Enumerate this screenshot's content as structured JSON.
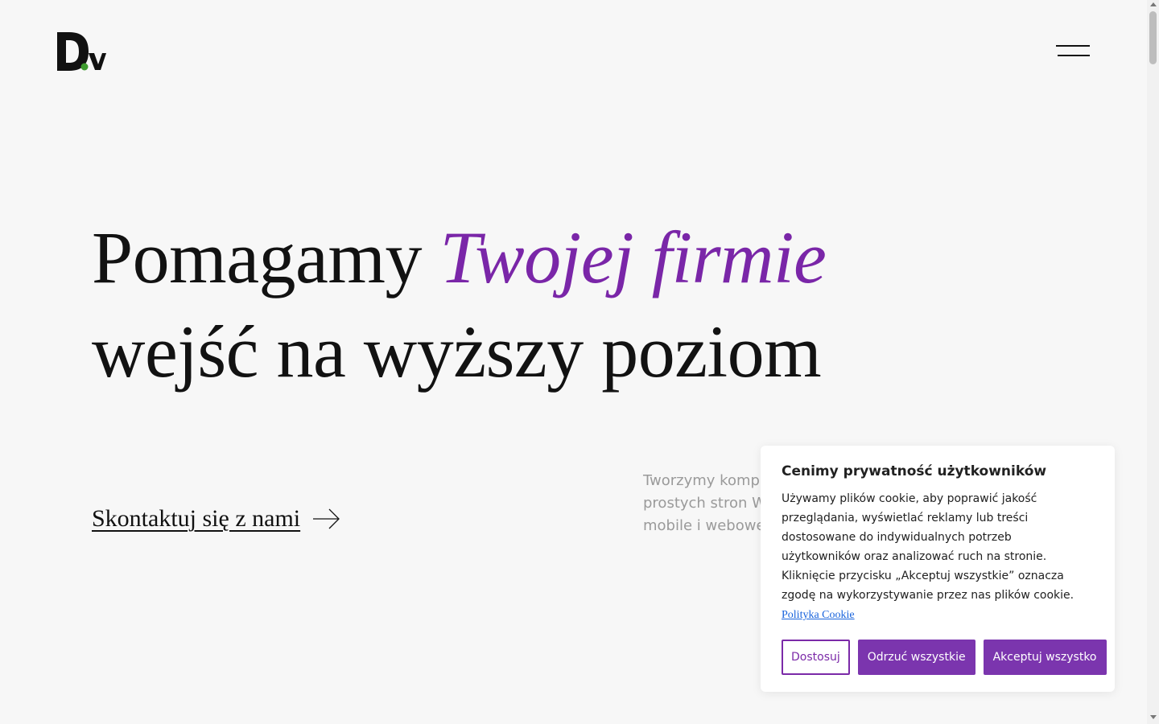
{
  "brand": {
    "logo_text": "Dv",
    "logo_dot_color": "#3d9b2e"
  },
  "header": {
    "menu_icon": "hamburger-icon"
  },
  "hero": {
    "title_part1": "Pomagamy ",
    "title_accent": "Twojej firmie",
    "title_part2": "wejść na wyższy poziom",
    "accent_color": "#7a26a8"
  },
  "cta": {
    "label": "Skontaktuj się z nami",
    "icon": "arrow-right-icon"
  },
  "intro": {
    "line1": "Tworzymy komp",
    "line2": "prostych stron W",
    "line3": "mobile i webowe"
  },
  "cookie_banner": {
    "title": "Cenimy prywatność użytkowników",
    "body": "Używamy plików cookie, aby poprawić jakość przeglądania, wyświetlać reklamy lub treści dostosowane do indywidualnych potrzeb użytkowników oraz analizować ruch na stronie. Kliknięcie przycisku „Akceptuj wszystkie” oznacza zgodę na wykorzystywanie przez nas plików cookie.",
    "policy_link": "Polityka Cookie",
    "customize_label": "Dostosuj",
    "reject_label": "Odrzuć wszystkie",
    "accept_label": "Akceptuj wszystko",
    "button_color": "#7b35ae"
  }
}
